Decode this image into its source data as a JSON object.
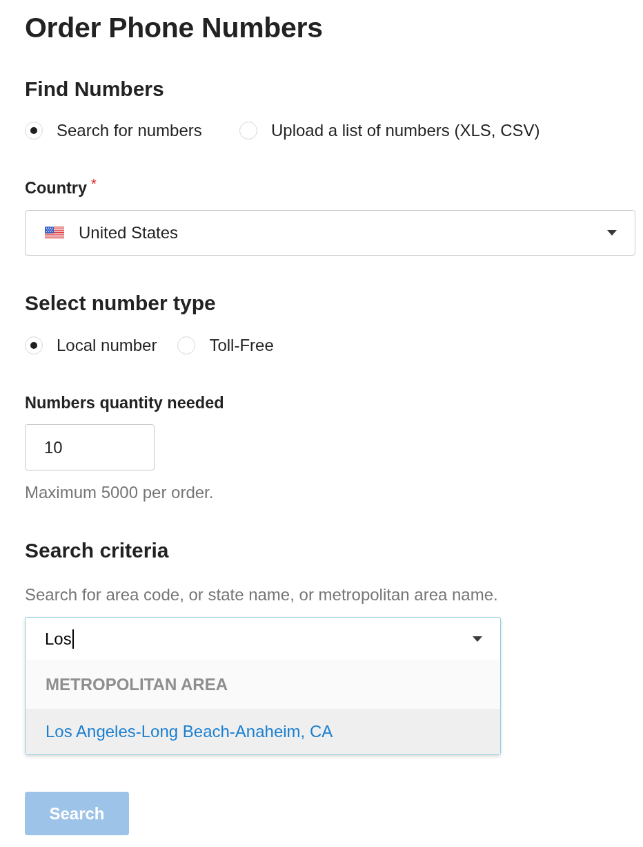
{
  "page": {
    "title": "Order Phone Numbers"
  },
  "find_numbers": {
    "heading": "Find Numbers",
    "options": [
      {
        "label": "Search for numbers",
        "selected": true
      },
      {
        "label": "Upload a list of numbers (XLS, CSV)",
        "selected": false
      }
    ]
  },
  "country": {
    "label": "Country",
    "required_mark": "*",
    "value": "United States"
  },
  "number_type": {
    "heading": "Select number type",
    "options": [
      {
        "label": "Local number",
        "selected": true
      },
      {
        "label": "Toll-Free",
        "selected": false
      }
    ]
  },
  "quantity": {
    "label": "Numbers quantity needed",
    "value": "10",
    "hint": "Maximum 5000 per order."
  },
  "search_criteria": {
    "heading": "Search criteria",
    "hint": "Search for area code, or state name, or metropolitan area name.",
    "value": "Los",
    "focused": true,
    "expanded": true,
    "groups": [
      {
        "heading": "METROPOLITAN AREA",
        "options": [
          {
            "label": "Los Angeles-Long Beach-Anaheim, CA",
            "highlighted": true
          }
        ]
      }
    ]
  },
  "search_button": {
    "label": "Search",
    "disabled": true
  }
}
